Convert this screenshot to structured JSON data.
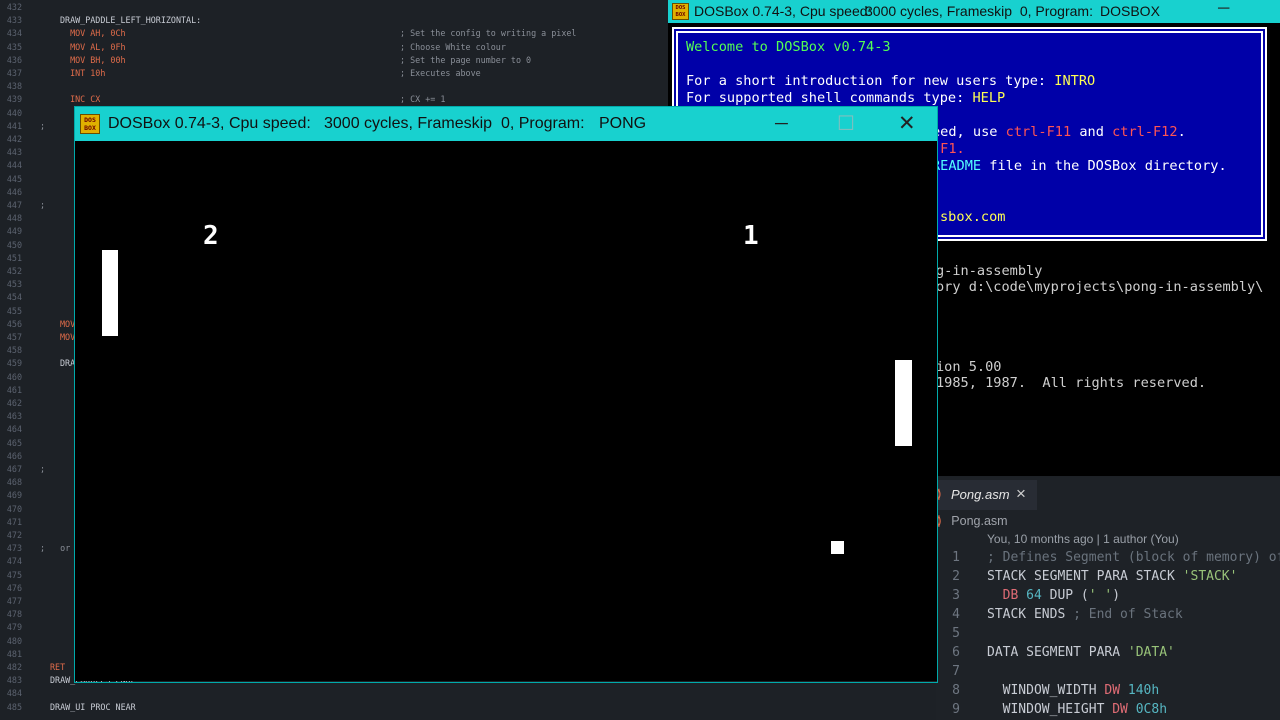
{
  "editor": {
    "lines": [
      {
        "n": "432",
        "code": "",
        "cmt": ""
      },
      {
        "n": "433",
        "code": "DRAW_PADDLE_LEFT_HORIZONTAL:",
        "cmt": ""
      },
      {
        "n": "434",
        "code": "  MOV AH, 0Ch",
        "cmt": "; Set the config to writing a pixel"
      },
      {
        "n": "435",
        "code": "  MOV AL, 0Fh",
        "cmt": "; Choose White colour"
      },
      {
        "n": "436",
        "code": "  MOV BH, 00h",
        "cmt": "; Set the page number to 0"
      },
      {
        "n": "437",
        "code": "  INT 10h",
        "cmt": "; Executes above"
      },
      {
        "n": "438",
        "code": "",
        "cmt": ""
      },
      {
        "n": "439",
        "code": "  INC CX",
        "cmt": "; CX += 1"
      },
      {
        "n": "440",
        "code": "",
        "cmt": ""
      },
      {
        "n": "441",
        "code": ";",
        "cmt": ""
      },
      {
        "n": "442",
        "code": "",
        "cmt": ""
      },
      {
        "n": "443",
        "code": "",
        "cmt": ""
      },
      {
        "n": "444",
        "code": "",
        "cmt": ""
      },
      {
        "n": "445",
        "code": "",
        "cmt": ""
      },
      {
        "n": "446",
        "code": "",
        "cmt": ""
      },
      {
        "n": "447",
        "code": ";",
        "cmt": ""
      },
      {
        "n": "448",
        "code": "",
        "cmt": ""
      },
      {
        "n": "449",
        "code": "",
        "cmt": ""
      },
      {
        "n": "450",
        "code": "",
        "cmt": ""
      },
      {
        "n": "451",
        "code": "",
        "cmt": ""
      },
      {
        "n": "452",
        "code": "",
        "cmt": ""
      },
      {
        "n": "453",
        "code": "",
        "cmt": ""
      },
      {
        "n": "454",
        "code": "",
        "cmt": ""
      },
      {
        "n": "455",
        "code": "",
        "cmt": ""
      },
      {
        "n": "456",
        "code": "MOV",
        "cmt": ""
      },
      {
        "n": "457",
        "code": "MOV",
        "cmt": ""
      },
      {
        "n": "458",
        "code": "",
        "cmt": ""
      },
      {
        "n": "459",
        "code": "DRA",
        "cmt": ""
      },
      {
        "n": "460",
        "code": "",
        "cmt": ""
      },
      {
        "n": "461",
        "code": "",
        "cmt": ""
      },
      {
        "n": "462",
        "code": "",
        "cmt": ""
      },
      {
        "n": "463",
        "code": "",
        "cmt": ""
      },
      {
        "n": "464",
        "code": "",
        "cmt": ""
      },
      {
        "n": "465",
        "code": "",
        "cmt": ""
      },
      {
        "n": "466",
        "code": "",
        "cmt": ""
      },
      {
        "n": "467",
        "code": ";",
        "cmt": ""
      },
      {
        "n": "468",
        "code": "",
        "cmt": ""
      },
      {
        "n": "469",
        "code": "",
        "cmt": ""
      },
      {
        "n": "470",
        "code": "",
        "cmt": ""
      },
      {
        "n": "471",
        "code": "",
        "cmt": ""
      },
      {
        "n": "472",
        "code": "",
        "cmt": ""
      },
      {
        "n": "473",
        "code": ";   or",
        "cmt": ""
      },
      {
        "n": "474",
        "code": "",
        "cmt": ""
      },
      {
        "n": "475",
        "code": "",
        "cmt": ""
      },
      {
        "n": "476",
        "code": "",
        "cmt": ""
      },
      {
        "n": "477",
        "code": "",
        "cmt": ""
      },
      {
        "n": "478",
        "code": "",
        "cmt": ""
      },
      {
        "n": "479",
        "code": "",
        "cmt": ""
      },
      {
        "n": "480",
        "code": "",
        "cmt": ""
      },
      {
        "n": "481",
        "code": "",
        "cmt": ""
      },
      {
        "n": "482",
        "code": "RET",
        "cmt": ""
      },
      {
        "n": "483",
        "code": "DRAW_PADDLES ENDP",
        "cmt": ""
      },
      {
        "n": "484",
        "code": "",
        "cmt": ""
      },
      {
        "n": "485",
        "code": "DRAW_UI PROC NEAR",
        "cmt": ""
      }
    ]
  },
  "shell_window": {
    "title_app": "DOSBox 0.74-3, Cpu speed:",
    "title_cycles": "3000 cycles, Frameskip  0, Program:",
    "title_program": "DOSBOX",
    "icon_text": "DOS BOX",
    "minimize_glyph": "─",
    "welcome": "Welcome to DOSBox v0.74-3",
    "intro_prefix": "For a short introduction for new users type: ",
    "intro_cmd": "INTRO",
    "help_prefix": "For supported shell commands type: ",
    "help_cmd": "HELP",
    "line3a": "eed, use ",
    "line3b": "ctrl-F11",
    "line3c": " and ",
    "line3d": "ctrl-F12",
    "line3e": ".",
    "line4": "-F1.",
    "line5a": "README",
    "line5b": " file in the DOSBox directory.",
    "line6": "sbox.com",
    "shell_lines": [
      "g-in-assembly",
      "ory d:\\code\\myprojects\\pong-in-assembly\\",
      "ion 5.00",
      "1985, 1987.  All rights reserved."
    ]
  },
  "vscode": {
    "tab_label": "Pong.asm",
    "tab_close": "×",
    "breadcrumb": "Pong.asm",
    "blame": "You, 10 months ago | 1 author (You)",
    "lines": [
      {
        "n": "1",
        "html": "<span class='cm'>; Defines Segment (block of memory) of</span>"
      },
      {
        "n": "2",
        "html": "STACK SEGMENT PARA STACK <span class='st'>'STACK'</span>"
      },
      {
        "n": "3",
        "html": "  <span class='kr'>DB</span> <span class='nm'>64</span> DUP (<span class='st'>' '</span>)"
      },
      {
        "n": "4",
        "html": "STACK ENDS <span class='cm'>; End of Stack</span>"
      },
      {
        "n": "5",
        "html": ""
      },
      {
        "n": "6",
        "html": "DATA SEGMENT PARA <span class='st'>'DATA'</span>"
      },
      {
        "n": "7",
        "html": ""
      },
      {
        "n": "8",
        "html": "  WINDOW_WIDTH <span class='kr'>DW</span> <span class='nm'>140h</span>"
      },
      {
        "n": "9",
        "html": "  WINDOW_HEIGHT <span class='kr'>DW</span> <span class='nm'>0C8h</span>"
      }
    ]
  },
  "pong_window": {
    "title_app": "DOSBox 0.74-3, Cpu speed:",
    "title_cycles": "3000 cycles, Frameskip  0, Program:",
    "title_program": "PONG",
    "icon_text": "DOS BOX",
    "minimize_glyph": "─",
    "maximize_glyph": "☐",
    "close_glyph": "✕",
    "score_left": "2",
    "score_right": "1"
  },
  "colors": {
    "titlebar": "#18d1cf",
    "dos_blue": "#0000a8",
    "dos_green": "#54fe54",
    "dos_yellow": "#fefe54",
    "dos_red": "#fe5454",
    "dos_cyan": "#54fefe"
  }
}
